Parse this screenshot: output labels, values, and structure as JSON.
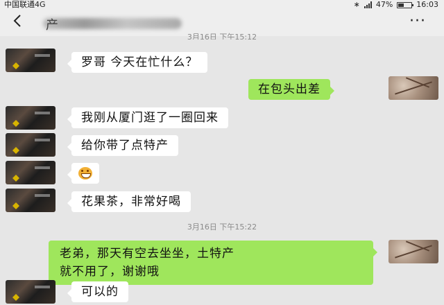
{
  "status_bar": {
    "carrier": "中国联通4G",
    "battery": "47%",
    "battery_level": 0.47,
    "time": "16:03",
    "icons": [
      "hd-icon",
      "image-icon",
      "bluetooth-icon",
      "signal-icon",
      "battery-icon"
    ]
  },
  "title_bar": {
    "back_icon": "chevron-left-icon",
    "title_first_char": "产",
    "more_icon": "more-dots-icon"
  },
  "timestamps": {
    "top": "3月16日 下午15:12",
    "middle": "3月16日 下午15:22"
  },
  "messages": [
    {
      "side": "left",
      "text": "罗哥 今天在忙什么？"
    },
    {
      "side": "right",
      "text": "在包头出差"
    },
    {
      "side": "left",
      "text": "我刚从厦门逛了一圈回来"
    },
    {
      "side": "left",
      "text": "给你带了点特产"
    },
    {
      "side": "left",
      "emoji": "grinning-face-emoji"
    },
    {
      "side": "left",
      "text": "花果茶，非常好喝"
    },
    {
      "side": "right",
      "lines": [
        "老弟，那天有空去坐坐，土特产",
        "就不用了，谢谢哦"
      ]
    },
    {
      "side": "left",
      "text": "可以的"
    }
  ],
  "colors": {
    "background": "#e6e6e6",
    "bubble_left": "#ffffff",
    "bubble_right": "#9fe65c"
  }
}
